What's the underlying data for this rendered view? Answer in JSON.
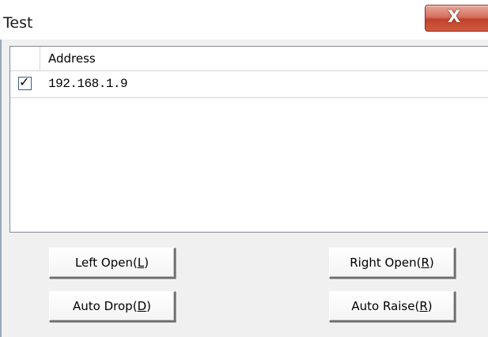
{
  "window": {
    "title": "Test",
    "close_glyph": "X"
  },
  "list": {
    "columns": [
      "",
      "Address"
    ],
    "rows": [
      {
        "checked": true,
        "check_glyph": "✓",
        "address": "192.168.1.9"
      }
    ]
  },
  "buttons": {
    "left_open": {
      "text": "Left Open(",
      "key": "L",
      "suffix": ")"
    },
    "right_open": {
      "text": "Right Open(",
      "key": "R",
      "suffix": ")"
    },
    "auto_drop": {
      "text": "Auto Drop(",
      "key": "D",
      "suffix": ")"
    },
    "auto_raise": {
      "text": "Auto Raise(",
      "key": "R",
      "suffix": ")"
    }
  },
  "colors": {
    "close_button": "#c2422c",
    "window_background": "#f0f0f0",
    "list_background": "#ffffff"
  }
}
